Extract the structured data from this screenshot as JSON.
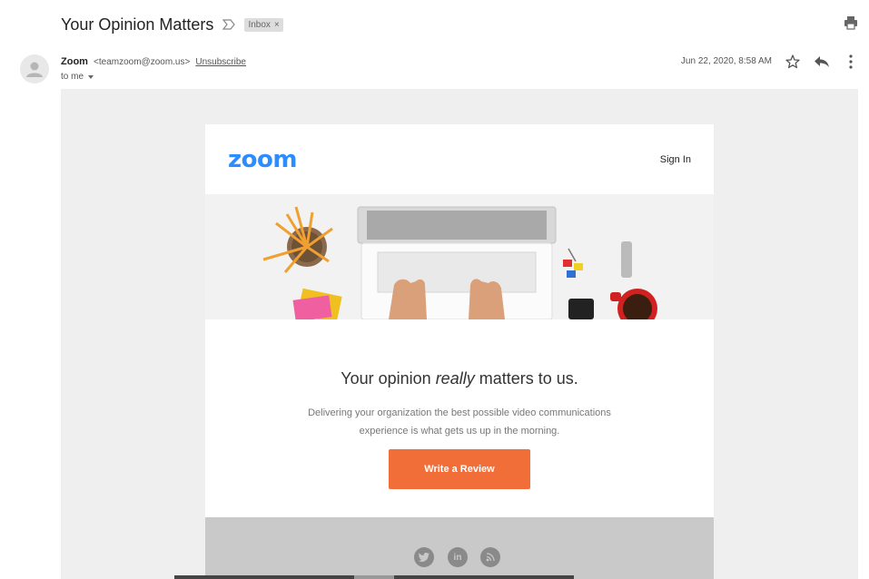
{
  "message": {
    "subject": "Your Opinion Matters",
    "label_chip": "Inbox",
    "label_chip_close": "×",
    "sender_name": "Zoom",
    "sender_email": "<teamzoom@zoom.us>",
    "unsubscribe": "Unsubscribe",
    "recipient": "to me",
    "date": "Jun 22, 2020, 8:58 AM"
  },
  "email": {
    "logo": "zoom",
    "sign_in": "Sign In",
    "headline_before": "Your opinion ",
    "headline_emphasis": "really",
    "headline_after": " matters to us.",
    "description": "Delivering your organization the best possible video communications experience is what gets us up in the morning.",
    "cta": "Write a Review",
    "social": [
      "twitter-icon",
      "linkedin-icon",
      "rss-icon"
    ],
    "social_linkedin_text": "in"
  },
  "colors": {
    "zoom_blue": "#2D8CFF",
    "cta_orange": "#F26E39",
    "email_background": "#efefef",
    "footer_gray": "#c9c9c9"
  }
}
